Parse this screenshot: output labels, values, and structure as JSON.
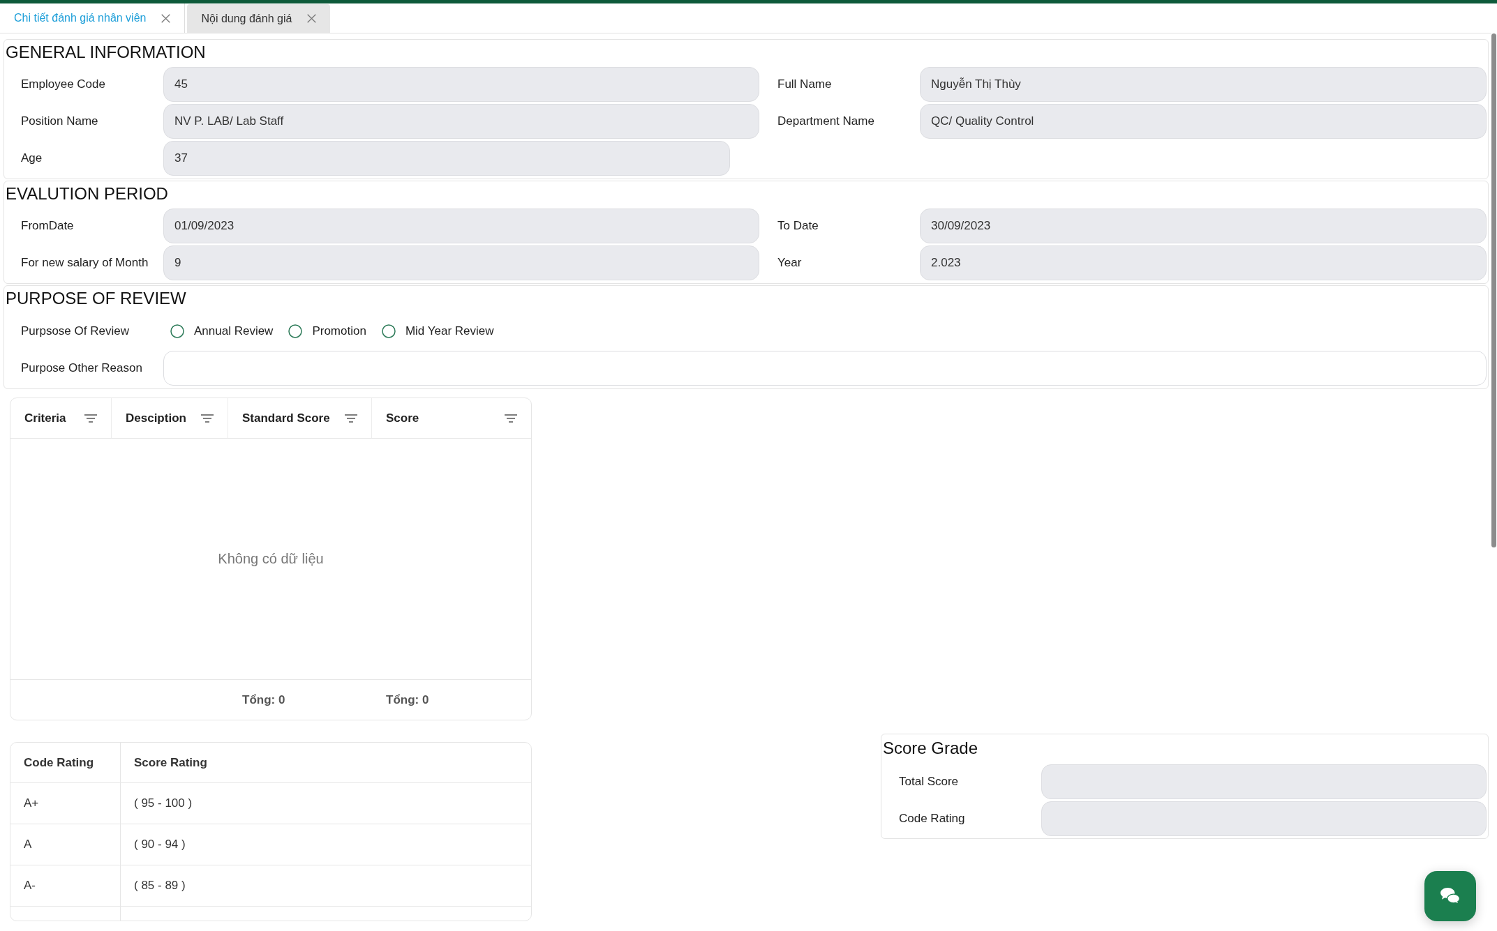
{
  "tabs": [
    {
      "label": "Chi tiết đánh giá nhân viên",
      "selected": true
    },
    {
      "label": "Nội dung đánh giá",
      "selected": false
    }
  ],
  "general_information": {
    "title": "GENERAL INFORMATION",
    "fields": [
      {
        "label": "Employee Code",
        "value": "45",
        "disabled": true
      },
      {
        "label": "Full Name",
        "value": "Nguyễn Thị Thùy",
        "disabled": true
      },
      {
        "label": "Position Name",
        "value": "NV P. LAB/ Lab Staff",
        "disabled": true
      },
      {
        "label": "Department Name",
        "value": "QC/ Quality Control",
        "disabled": true
      },
      {
        "label": "Age",
        "value": "37",
        "disabled": true
      }
    ]
  },
  "evaluation_period": {
    "title": "EVALUTION PERIOD",
    "fields": [
      {
        "label": "FromDate",
        "value": "01/09/2023",
        "disabled": true
      },
      {
        "label": "To Date",
        "value": "30/09/2023",
        "disabled": true
      },
      {
        "label": "For new salary of Month",
        "value": "9",
        "disabled": true
      },
      {
        "label": "Year",
        "value": "2.023",
        "disabled": true
      }
    ]
  },
  "purpose_of_review": {
    "title": "PURPOSE OF REVIEW",
    "purpose": {
      "label": "Purpsose Of Review",
      "options": [
        {
          "label": "Annual Review",
          "selected": false
        },
        {
          "label": "Promotion",
          "selected": false
        },
        {
          "label": "Mid Year Review",
          "selected": false
        }
      ]
    },
    "other_reason": {
      "label": "Purpose Other Reason",
      "disabled": false
    }
  },
  "criteria_table": {
    "columns": [
      {
        "label": "Criteria"
      },
      {
        "label": "Desciption"
      },
      {
        "label": "Standard Score",
        "total": "Tổng: 0"
      },
      {
        "label": "Score",
        "total": "Tổng: 0"
      }
    ],
    "empty_text": "Không có dữ liệu"
  },
  "rating_table": {
    "columns": [
      {
        "label": "Code Rating"
      },
      {
        "label": "Score Rating"
      }
    ],
    "rows": [
      [
        "A+",
        "( 95 - 100 )"
      ],
      [
        "A",
        "( 90 - 94 )"
      ],
      [
        "A-",
        "( 85 - 89 )"
      ]
    ]
  },
  "score_grade": {
    "title": "Score Grade",
    "fields": [
      {
        "label": "Total Score",
        "disabled": true
      },
      {
        "label": "Code Rating",
        "disabled": true
      }
    ]
  }
}
